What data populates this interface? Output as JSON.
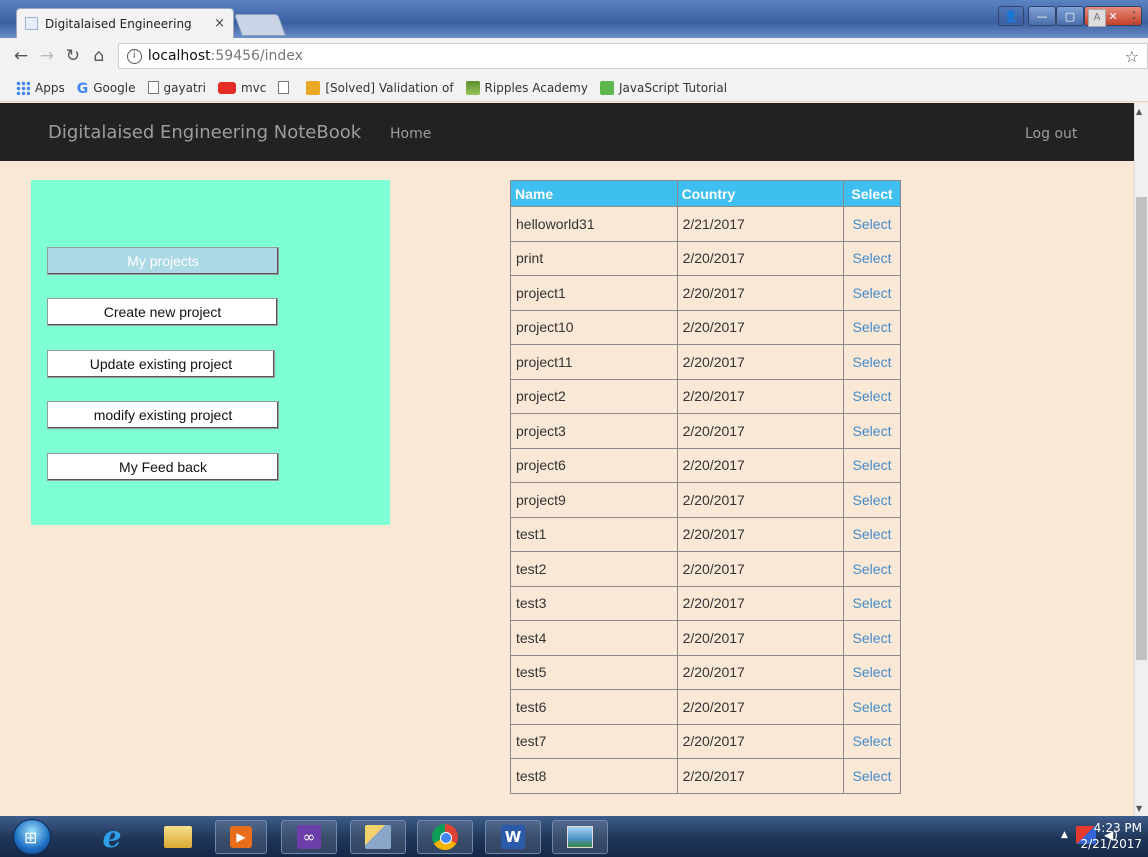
{
  "browser": {
    "tab_title": "Digitalaised Engineering",
    "tab_close": "×",
    "url_host": "localhost",
    "url_path": ":59456/index",
    "bookmarks": [
      "Apps",
      "Google",
      "gayatri",
      "mvc",
      "",
      "[Solved] Validation of",
      "Ripples Academy",
      "JavaScript Tutorial"
    ]
  },
  "navbar": {
    "brand": "Digitalaised Engineering NoteBook",
    "home": "Home",
    "logout": "Log out"
  },
  "sidebar": {
    "buttons": [
      "My projects",
      "Create new project",
      "Update existing project",
      "modify existing project",
      "My Feed back"
    ],
    "active_index": 0
  },
  "table": {
    "headers": [
      "Name",
      "Country",
      "Select"
    ],
    "rows": [
      {
        "name": "helloworld31",
        "date": "2/21/2017",
        "action": "Select"
      },
      {
        "name": "print",
        "date": "2/20/2017",
        "action": "Select"
      },
      {
        "name": "project1",
        "date": "2/20/2017",
        "action": "Select"
      },
      {
        "name": "project10",
        "date": "2/20/2017",
        "action": "Select"
      },
      {
        "name": "project11",
        "date": "2/20/2017",
        "action": "Select"
      },
      {
        "name": "project2",
        "date": "2/20/2017",
        "action": "Select"
      },
      {
        "name": "project3",
        "date": "2/20/2017",
        "action": "Select"
      },
      {
        "name": "project6",
        "date": "2/20/2017",
        "action": "Select"
      },
      {
        "name": "project9",
        "date": "2/20/2017",
        "action": "Select"
      },
      {
        "name": "test1",
        "date": "2/20/2017",
        "action": "Select"
      },
      {
        "name": "test2",
        "date": "2/20/2017",
        "action": "Select"
      },
      {
        "name": "test3",
        "date": "2/20/2017",
        "action": "Select"
      },
      {
        "name": "test4",
        "date": "2/20/2017",
        "action": "Select"
      },
      {
        "name": "test5",
        "date": "2/20/2017",
        "action": "Select"
      },
      {
        "name": "test6",
        "date": "2/20/2017",
        "action": "Select"
      },
      {
        "name": "test7",
        "date": "2/20/2017",
        "action": "Select"
      },
      {
        "name": "test8",
        "date": "2/20/2017",
        "action": "Select"
      }
    ]
  },
  "taskbar": {
    "time": "4:23 PM",
    "date": "2/21/2017",
    "apps": [
      "ie-icon",
      "file-explorer-icon",
      "media-player-icon",
      "visual-studio-icon",
      "tools-icon",
      "chrome-icon",
      "word-icon",
      "photo-viewer-icon"
    ]
  },
  "colors": {
    "page_bg": "#f9e8d5",
    "navbar_bg": "#222222",
    "sidebar_bg": "#7fffd4",
    "active_button_bg": "#add8e6",
    "table_header_bg": "#3fbef0",
    "link": "#428bca"
  }
}
